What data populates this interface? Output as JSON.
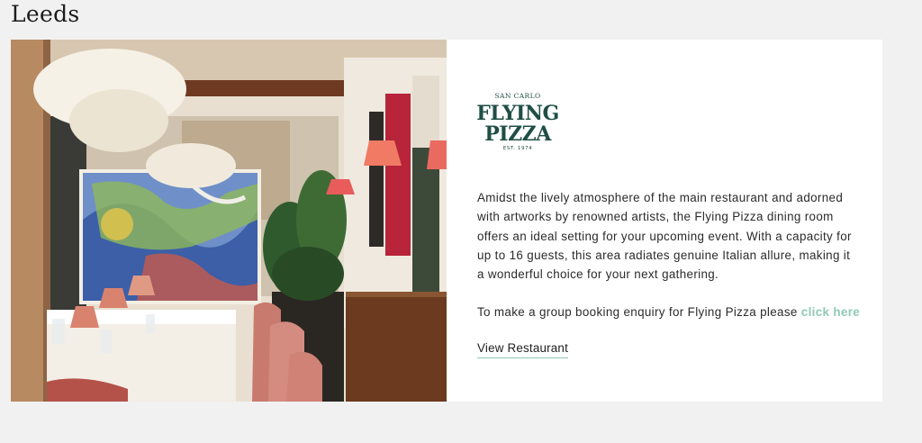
{
  "page": {
    "heading": "Leeds"
  },
  "venue": {
    "logo": {
      "top_text": "SAN CARLO",
      "line1": "FLYING",
      "line2": "PIZZA",
      "est": "EST. 1974",
      "color": "#1f4e45"
    },
    "photo_icon": "restaurant-dining-room-photo",
    "description": "Amidst the lively atmosphere of the main restaurant and adorned with artworks by renowned artists, the Flying Pizza dining room offers an ideal setting for your upcoming event. With a capacity for up to 16 guests, this area radiates genuine Italian allure, making it a wonderful choice for your next gathering.",
    "enquiry_text": "To make a group booking enquiry for Flying Pizza please ",
    "enquiry_link": "click here",
    "view_link": "View Restaurant",
    "accent_color": "#8fcab4"
  }
}
